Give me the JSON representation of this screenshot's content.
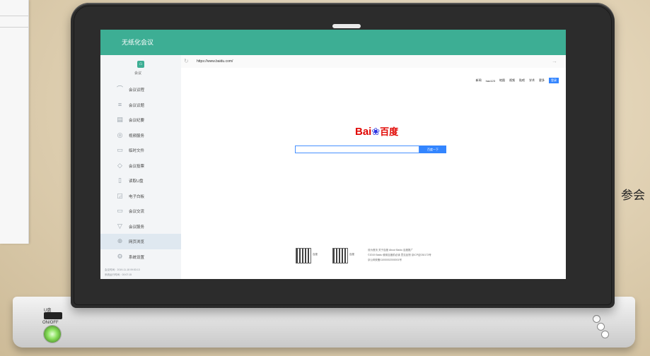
{
  "background": {
    "right_text": "参会"
  },
  "app": {
    "title": "无纸化会议",
    "accent_color": "#3dae94"
  },
  "sidebar": {
    "home_label": "会议",
    "items": [
      {
        "label": "会议议程",
        "icon": "agenda-icon"
      },
      {
        "label": "会议议题",
        "icon": "list-icon"
      },
      {
        "label": "会议纪要",
        "icon": "notes-icon"
      },
      {
        "label": "视频服务",
        "icon": "video-icon"
      },
      {
        "label": "临时文件",
        "icon": "folder-icon"
      },
      {
        "label": "会议投票",
        "icon": "vote-icon"
      },
      {
        "label": "读取U盘",
        "icon": "usb-icon"
      },
      {
        "label": "电子白板",
        "icon": "whiteboard-icon"
      },
      {
        "label": "会议交流",
        "icon": "chat-icon"
      },
      {
        "label": "会议服务",
        "icon": "service-icon"
      },
      {
        "label": "网页浏览",
        "icon": "globe-icon",
        "active": true
      },
      {
        "label": "系统设置",
        "icon": "settings-icon"
      }
    ],
    "footer": [
      "会议时间：2019-11-18 09:53:13",
      "系统运行时间：00:07:15"
    ]
  },
  "browser": {
    "url": "https://www.baidu.com/",
    "page": {
      "nav_links": [
        "新闻",
        "hao123",
        "地图",
        "视频",
        "贴吧",
        "学术",
        "更多"
      ],
      "login_label": "登录",
      "logo_left": "Bai",
      "logo_right": "百度",
      "search_button": "百度一下",
      "qr_left_label": "百度",
      "qr_right_label": "百度",
      "footer_lines": [
        "设为首页 关于百度 About Baidu 百度推广",
        "©2019 Baidu 使用百度前必读 意见反馈 京ICP证030173号",
        "京公网安备11000002000001号"
      ]
    }
  },
  "device": {
    "usb_label": "U盘",
    "power_label": "ON/OFF"
  }
}
